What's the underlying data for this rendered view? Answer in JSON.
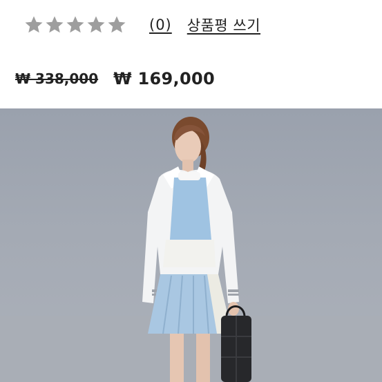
{
  "rating": {
    "stars": 5,
    "star_color": "#9e9e9e",
    "review_count": "(0)",
    "write_review": "상품평 쓰기"
  },
  "price": {
    "original": "₩ 338,000",
    "sale": "₩ 169,000"
  },
  "product_image": {
    "description_icon": "model-photo",
    "background_color": "#a4aab4"
  }
}
